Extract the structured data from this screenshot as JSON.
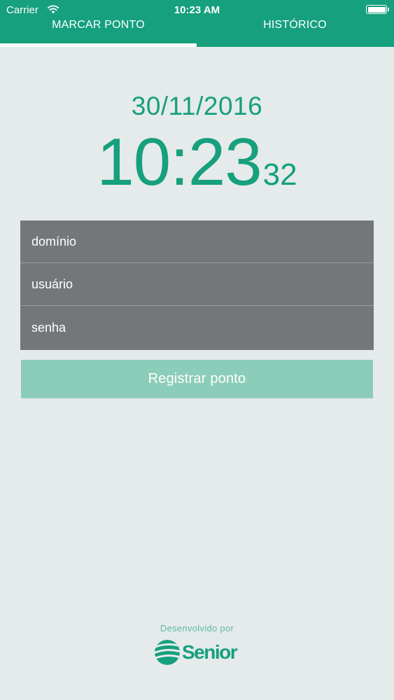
{
  "status_bar": {
    "carrier": "Carrier",
    "time": "10:23 AM",
    "wifi_icon": "wifi-icon",
    "battery_icon": "battery-icon"
  },
  "tabs": [
    {
      "label": "MARCAR PONTO",
      "active": true
    },
    {
      "label": "HISTÓRICO",
      "active": false
    }
  ],
  "clock": {
    "date": "30/11/2016",
    "hours_minutes": "10:23",
    "seconds": "32"
  },
  "form": {
    "domain_placeholder": "domínio",
    "user_placeholder": "usuário",
    "password_placeholder": "senha"
  },
  "register_button": {
    "label": "Registrar ponto"
  },
  "footer": {
    "developed_by": "Desenvolvido por",
    "brand": "Senior",
    "logo_icon": "senior-logo-icon"
  },
  "colors": {
    "brand_green": "#16a07d",
    "background": "#e5eaeb",
    "field_gray": "#737779",
    "button_disabled_green": "#8ccdb9"
  }
}
